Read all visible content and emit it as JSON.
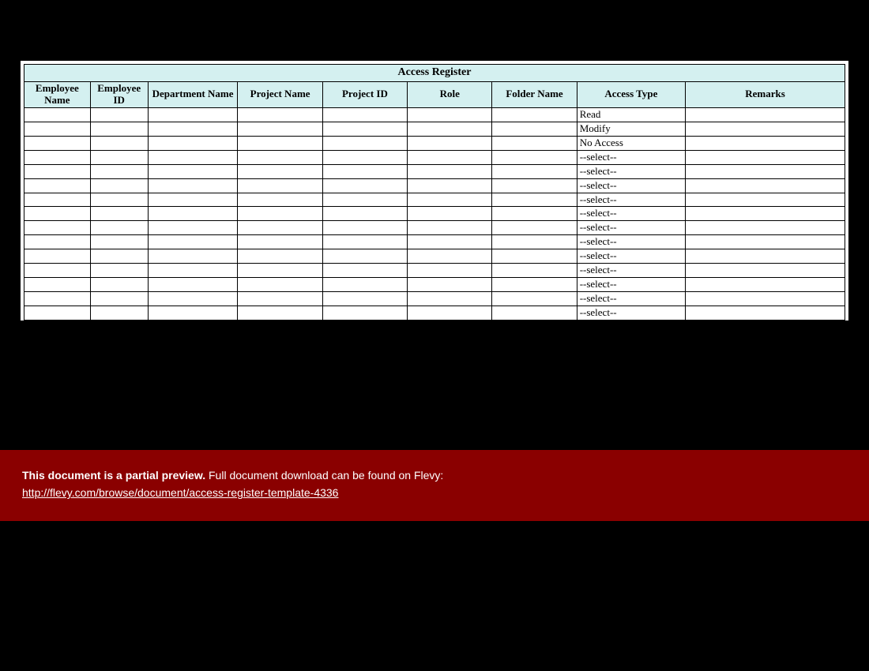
{
  "table": {
    "title": "Access Register",
    "columns": [
      "Employee Name",
      "Employee ID",
      "Department Name",
      "Project Name",
      "Project ID",
      "Role",
      "Folder Name",
      "Access Type",
      "Remarks"
    ],
    "rows": [
      {
        "employee_name": "",
        "employee_id": "",
        "department_name": "",
        "project_name": "",
        "project_id": "",
        "role": "",
        "folder_name": "",
        "access_type": "Read",
        "remarks": ""
      },
      {
        "employee_name": "",
        "employee_id": "",
        "department_name": "",
        "project_name": "",
        "project_id": "",
        "role": "",
        "folder_name": "",
        "access_type": "Modify",
        "remarks": ""
      },
      {
        "employee_name": "",
        "employee_id": "",
        "department_name": "",
        "project_name": "",
        "project_id": "",
        "role": "",
        "folder_name": "",
        "access_type": "No Access",
        "remarks": ""
      },
      {
        "employee_name": "",
        "employee_id": "",
        "department_name": "",
        "project_name": "",
        "project_id": "",
        "role": "",
        "folder_name": "",
        "access_type": "--select--",
        "remarks": ""
      },
      {
        "employee_name": "",
        "employee_id": "",
        "department_name": "",
        "project_name": "",
        "project_id": "",
        "role": "",
        "folder_name": "",
        "access_type": "--select--",
        "remarks": ""
      },
      {
        "employee_name": "",
        "employee_id": "",
        "department_name": "",
        "project_name": "",
        "project_id": "",
        "role": "",
        "folder_name": "",
        "access_type": "--select--",
        "remarks": ""
      },
      {
        "employee_name": "",
        "employee_id": "",
        "department_name": "",
        "project_name": "",
        "project_id": "",
        "role": "",
        "folder_name": "",
        "access_type": "--select--",
        "remarks": ""
      },
      {
        "employee_name": "",
        "employee_id": "",
        "department_name": "",
        "project_name": "",
        "project_id": "",
        "role": "",
        "folder_name": "",
        "access_type": "--select--",
        "remarks": ""
      },
      {
        "employee_name": "",
        "employee_id": "",
        "department_name": "",
        "project_name": "",
        "project_id": "",
        "role": "",
        "folder_name": "",
        "access_type": "--select--",
        "remarks": ""
      },
      {
        "employee_name": "",
        "employee_id": "",
        "department_name": "",
        "project_name": "",
        "project_id": "",
        "role": "",
        "folder_name": "",
        "access_type": "--select--",
        "remarks": ""
      },
      {
        "employee_name": "",
        "employee_id": "",
        "department_name": "",
        "project_name": "",
        "project_id": "",
        "role": "",
        "folder_name": "",
        "access_type": "--select--",
        "remarks": ""
      },
      {
        "employee_name": "",
        "employee_id": "",
        "department_name": "",
        "project_name": "",
        "project_id": "",
        "role": "",
        "folder_name": "",
        "access_type": "--select--",
        "remarks": ""
      },
      {
        "employee_name": "",
        "employee_id": "",
        "department_name": "",
        "project_name": "",
        "project_id": "",
        "role": "",
        "folder_name": "",
        "access_type": "--select--",
        "remarks": ""
      },
      {
        "employee_name": "",
        "employee_id": "",
        "department_name": "",
        "project_name": "",
        "project_id": "",
        "role": "",
        "folder_name": "",
        "access_type": "--select--",
        "remarks": ""
      },
      {
        "employee_name": "",
        "employee_id": "",
        "department_name": "",
        "project_name": "",
        "project_id": "",
        "role": "",
        "folder_name": "",
        "access_type": "--select--",
        "remarks": ""
      }
    ]
  },
  "banner": {
    "strong": "This document is a partial preview.",
    "rest": "  Full document download can be found on Flevy:",
    "link_text": "http://flevy.com/browse/document/access-register-template-4336"
  }
}
